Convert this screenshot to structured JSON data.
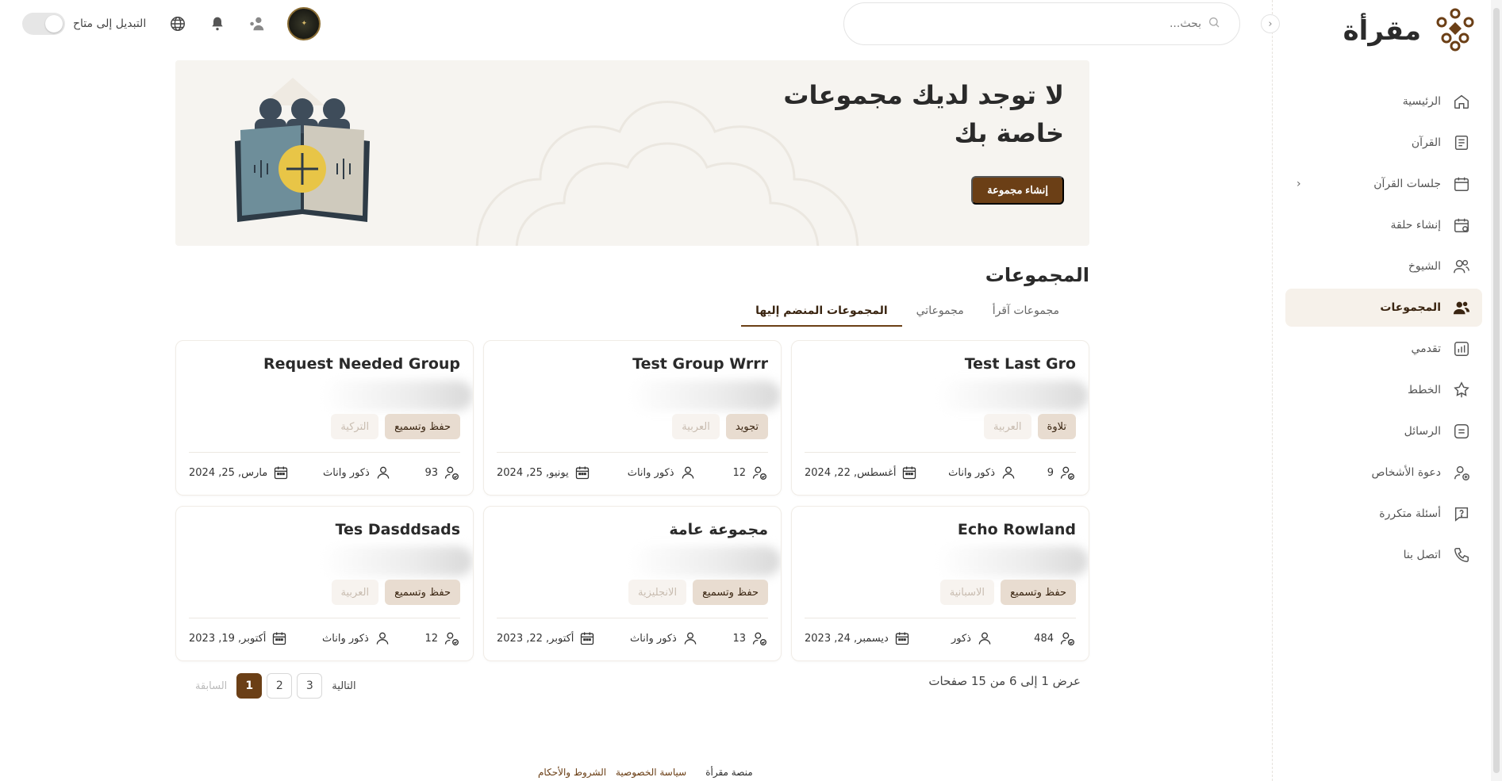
{
  "app": {
    "brand": "مقرأة"
  },
  "search": {
    "placeholder": "بحث..."
  },
  "topbar": {
    "switch_label": "التبديل إلى متاح"
  },
  "sidebar": {
    "items": [
      {
        "label": "الرئيسية",
        "icon": "home-icon"
      },
      {
        "label": "القرآن",
        "icon": "book-icon"
      },
      {
        "label": "جلسات القرآن",
        "icon": "calendar-icon",
        "has_chevron": true
      },
      {
        "label": "إنشاء حلقة",
        "icon": "calendar-plus-icon"
      },
      {
        "label": "الشيوخ",
        "icon": "users-icon"
      },
      {
        "label": "المجموعات",
        "icon": "group-icon",
        "active": true
      },
      {
        "label": "تقدمي",
        "icon": "chart-icon"
      },
      {
        "label": "الخطط",
        "icon": "award-icon"
      },
      {
        "label": "الرسائل",
        "icon": "message-icon"
      },
      {
        "label": "دعوة الأشخاص",
        "icon": "user-invite-icon"
      },
      {
        "label": "أسئلة متكررة",
        "icon": "help-icon"
      },
      {
        "label": "اتصل بنا",
        "icon": "phone-icon"
      }
    ]
  },
  "banner": {
    "title": "لا توجد لديك مجموعات خاصة بك",
    "button": "إنشاء مجموعة"
  },
  "groups": {
    "section_title": "المجموعات",
    "tabs": [
      {
        "label": "مجموعات آقرأ",
        "active": false
      },
      {
        "label": "مجموعاتي",
        "active": false
      },
      {
        "label": "المجموعات المنضم إليها",
        "active": true
      }
    ],
    "cards": [
      {
        "title": "Test Last Gro",
        "tags": [
          "تلاوة",
          "العربية"
        ],
        "members": "9",
        "teacher": "ذكور واناث",
        "date": "أغسطس, 22, 2024"
      },
      {
        "title": "Test Group Wrrr",
        "tags": [
          "تجويد",
          "العربية"
        ],
        "members": "12",
        "teacher": "ذكور واناث",
        "date": "يونيو, 25, 2024"
      },
      {
        "title": "Request Needed Group",
        "tags": [
          "حفظ وتسميع",
          "التركية"
        ],
        "members": "93",
        "teacher": "ذكور واناث",
        "date": "مارس, 25, 2024"
      },
      {
        "title": "Echo Rowland",
        "tags": [
          "حفظ وتسميع",
          "الاسبانية"
        ],
        "members": "484",
        "teacher": "ذكور",
        "date": "ديسمبر, 24, 2023"
      },
      {
        "title": "مجموعة عامة",
        "tags": [
          "حفظ وتسميع",
          "الانجليزية"
        ],
        "members": "13",
        "teacher": "ذكور واناث",
        "date": "أكتوبر, 22, 2023"
      },
      {
        "title": "Tes Dasddsads",
        "tags": [
          "حفظ وتسميع",
          "العربية"
        ],
        "members": "12",
        "teacher": "ذكور واناث",
        "date": "أكتوبر, 19, 2023"
      }
    ]
  },
  "pagination": {
    "info": "عرض 1 إلى 6 من 15 صفحات",
    "prev": "السابقة",
    "next": "التالية",
    "pages": [
      "1",
      "2",
      "3"
    ],
    "current": "1"
  },
  "footer": {
    "brand": "منصة مقرأة",
    "privacy": "سياسة الخصوصية",
    "terms": "الشروط والأحكام"
  },
  "colors": {
    "accent": "#6b3f16",
    "banner_bg": "#f6f4f0",
    "active_nav_bg": "#f6f1ea"
  }
}
